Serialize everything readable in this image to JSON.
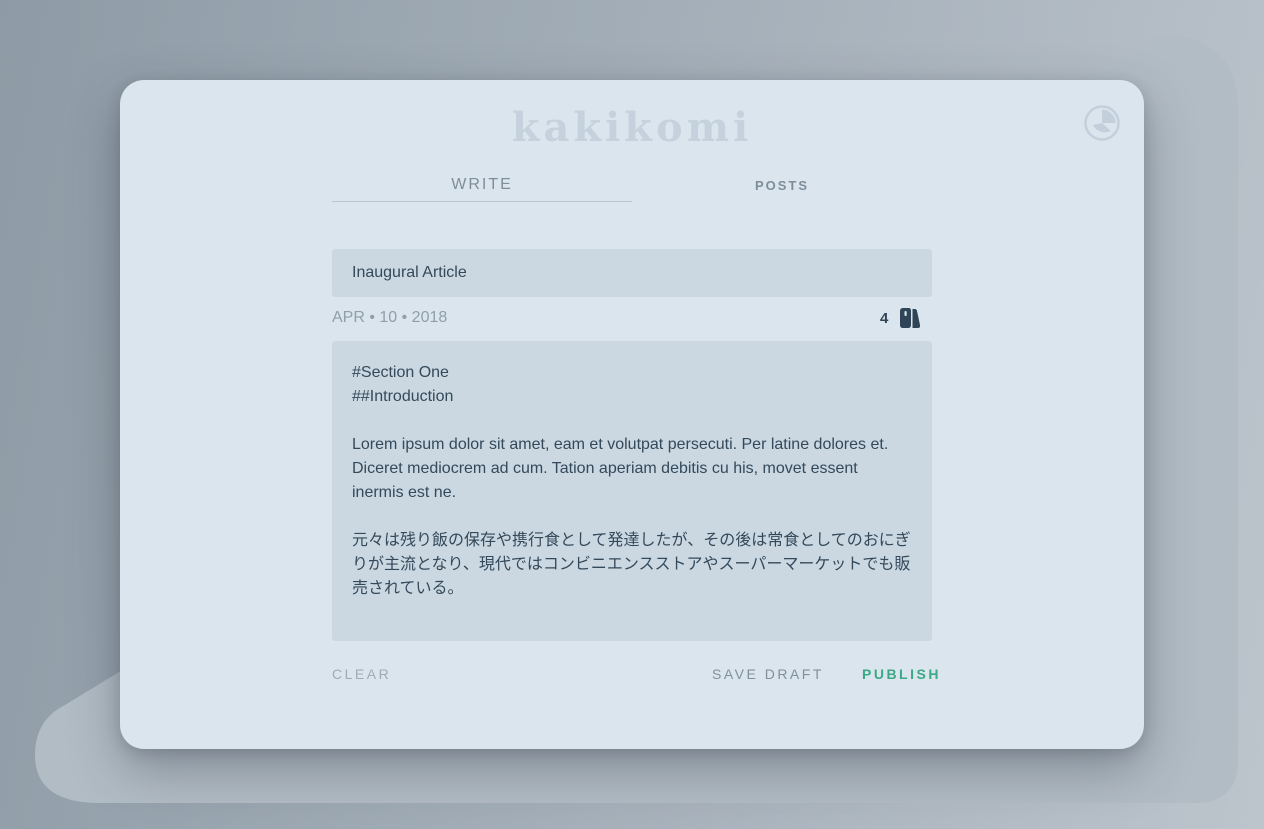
{
  "app": {
    "logo": "kakikomi"
  },
  "icons": {
    "theme_toggle": "theme-toggle-icon",
    "count": "sections-count-icon"
  },
  "tabs": [
    {
      "label": "WRITE",
      "active": true
    },
    {
      "label": "POSTS",
      "active": false
    }
  ],
  "editor": {
    "title_value": "Inaugural Article",
    "date": "APR • 10 • 2018",
    "count": "4",
    "body": "#Section One\n##Introduction\n\nLorem ipsum dolor sit amet, eam et volutpat persecuti. Per latine dolores et. Diceret mediocrem ad cum. Tation aperiam debitis cu his, movet essent inermis est ne.\n\n元々は残り飯の保存や携行食として発達したが、その後は常食としてのおにぎりが主流となり、現代ではコンビニエンスストアやスーパーマーケットでも販売されている。"
  },
  "actions": {
    "clear": "CLEAR",
    "save_draft": "SAVE DRAFT",
    "publish": "PUBLISH"
  },
  "colors": {
    "card_background": "#dbe5ee",
    "field_background": "#cbd8e2",
    "publish_accent": "#3aa985",
    "text_dark": "#34495a"
  }
}
